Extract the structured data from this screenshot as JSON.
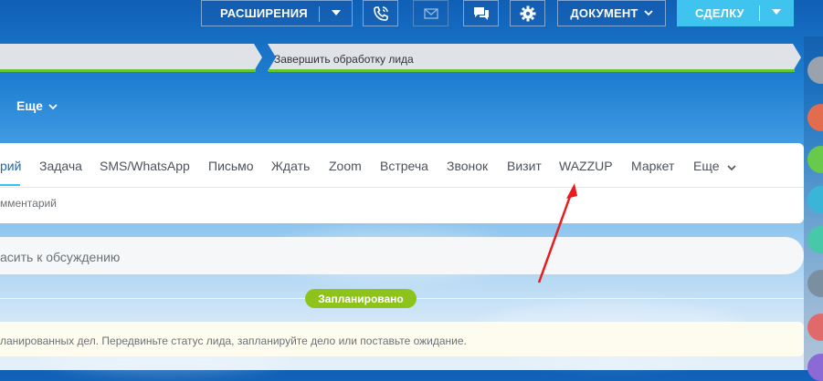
{
  "toolbar": {
    "extensions_label": "РАСШИРЕНИЯ",
    "document_label": "ДОКУМЕНТ",
    "deal_label": "СДЕЛКУ"
  },
  "stages": {
    "finish_label": "Завершить обработку лида"
  },
  "header": {
    "more_label": "Еще"
  },
  "tabs": [
    {
      "label": "рий"
    },
    {
      "label": "Задача"
    },
    {
      "label": "SMS/WhatsApp"
    },
    {
      "label": "Письмо"
    },
    {
      "label": "Ждать"
    },
    {
      "label": "Zoom"
    },
    {
      "label": "Встреча"
    },
    {
      "label": "Звонок"
    },
    {
      "label": "Визит"
    },
    {
      "label": "WAZZUP"
    },
    {
      "label": "Маркет"
    },
    {
      "label": "Еще"
    }
  ],
  "editor": {
    "comment_placeholder": "мментарий"
  },
  "timeline": {
    "discuss_placeholder": "асить к обсуждению",
    "planned_badge": "Запланировано",
    "notice": "ланированных дел. Передвиньте статус лида, запланируйте дело или поставьте ожидание."
  },
  "colors": {
    "accent": "#2fc6f6",
    "stage_done": "#62c62c",
    "badge": "#8ec31c",
    "arrow": "#e81c1c"
  }
}
